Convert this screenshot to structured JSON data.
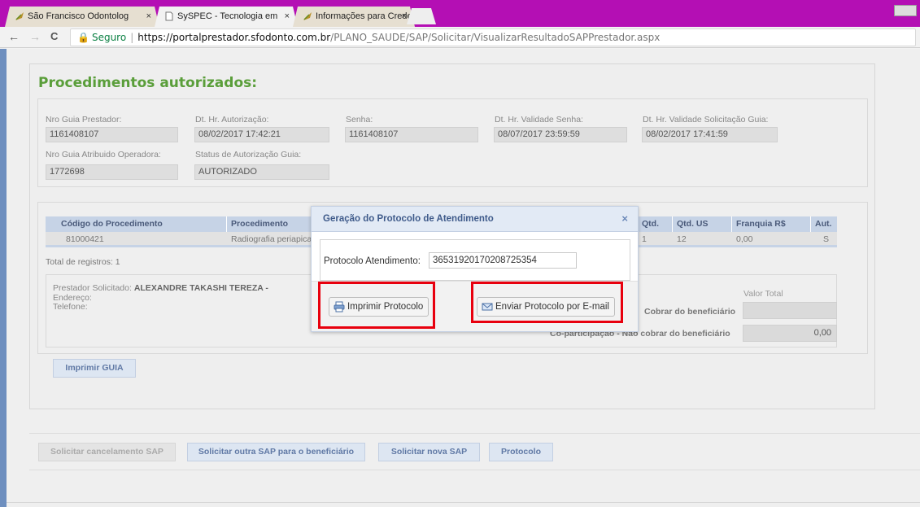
{
  "browser": {
    "tabs": [
      {
        "title": "São Francisco Odontolog",
        "active": false
      },
      {
        "title": "SySPEC - Tecnologia em",
        "active": true
      },
      {
        "title": "Informações para Creden",
        "active": false
      }
    ],
    "close_glyph": "×",
    "nav": {
      "back": "←",
      "forward": "→",
      "reload": "C"
    },
    "url": {
      "secure_label": "Seguro",
      "separator": "|",
      "host": "https://portalprestador.sfodonto.com.br",
      "path": "/PLANO_SAUDE/SAP/Solicitar/VisualizarResultadoSAPPrestador.aspx"
    }
  },
  "page": {
    "title": "Procedimentos autorizados:",
    "fields": {
      "nro_guia_prestador": {
        "label": "Nro Guia Prestador:",
        "value": "1161408107"
      },
      "dt_autorizacao": {
        "label": "Dt. Hr. Autorização:",
        "value": "08/02/2017 17:42:21"
      },
      "senha": {
        "label": "Senha:",
        "value": "1161408107"
      },
      "validade_senha": {
        "label": "Dt. Hr. Validade Senha:",
        "value": "08/07/2017 23:59:59"
      },
      "validade_solicitacao": {
        "label": "Dt. Hr. Validade Solicitação Guia:",
        "value": "08/02/2017 17:41:59"
      },
      "nro_guia_operadora": {
        "label": "Nro Guia Atribuido Operadora:",
        "value": "1772698"
      },
      "status_autorizacao": {
        "label": "Status de Autorização Guia:",
        "value": "AUTORIZADO"
      }
    },
    "grid": {
      "headers": {
        "codigo": "Código do Procedimento",
        "procedimento": "Procedimento",
        "qtd": "Qtd.",
        "qtd_us": "Qtd. US",
        "franquia": "Franquia R$",
        "aut": "Aut."
      },
      "rows": [
        {
          "codigo": "81000421",
          "procedimento": "Radiografia periapical",
          "qtd": "1",
          "qtd_us": "12",
          "franquia": "0,00",
          "aut": "S"
        }
      ],
      "total": "Total de registros: 1"
    },
    "prestador": {
      "label": "Prestador Solicitado:",
      "name": "ALEXANDRE TAKASHI TEREZA -",
      "endereco": "Endereço:",
      "telefone": "Telefone:"
    },
    "valores": {
      "header": "Valor Total",
      "row1_label": "Cobrar do beneficiário",
      "row1_value": "",
      "row2_label": "Co-participação - Não cobrar do beneficiário",
      "row2_value": "0,00"
    },
    "imprimir_guia": "Imprimir GUIA",
    "bottom_buttons": {
      "cancelar": "Solicitar cancelamento SAP",
      "outra_sap": "Solicitar outra SAP para o beneficiário",
      "nova_sap": "Solicitar nova SAP",
      "protocolo": "Protocolo"
    }
  },
  "modal": {
    "title": "Geração do Protocolo de Atendimento",
    "close": "×",
    "protocolo_label": "Protocolo Atendimento:",
    "protocolo_value": "36531920170208725354",
    "print_button": "Imprimir Protocolo",
    "email_button": "Enviar Protocolo por E-mail"
  },
  "colors": {
    "tab_strip": "#b40fb4",
    "title_green": "#5a9e3a",
    "highlight_red": "#e8000e",
    "grid_header": "#c6d3e6"
  }
}
